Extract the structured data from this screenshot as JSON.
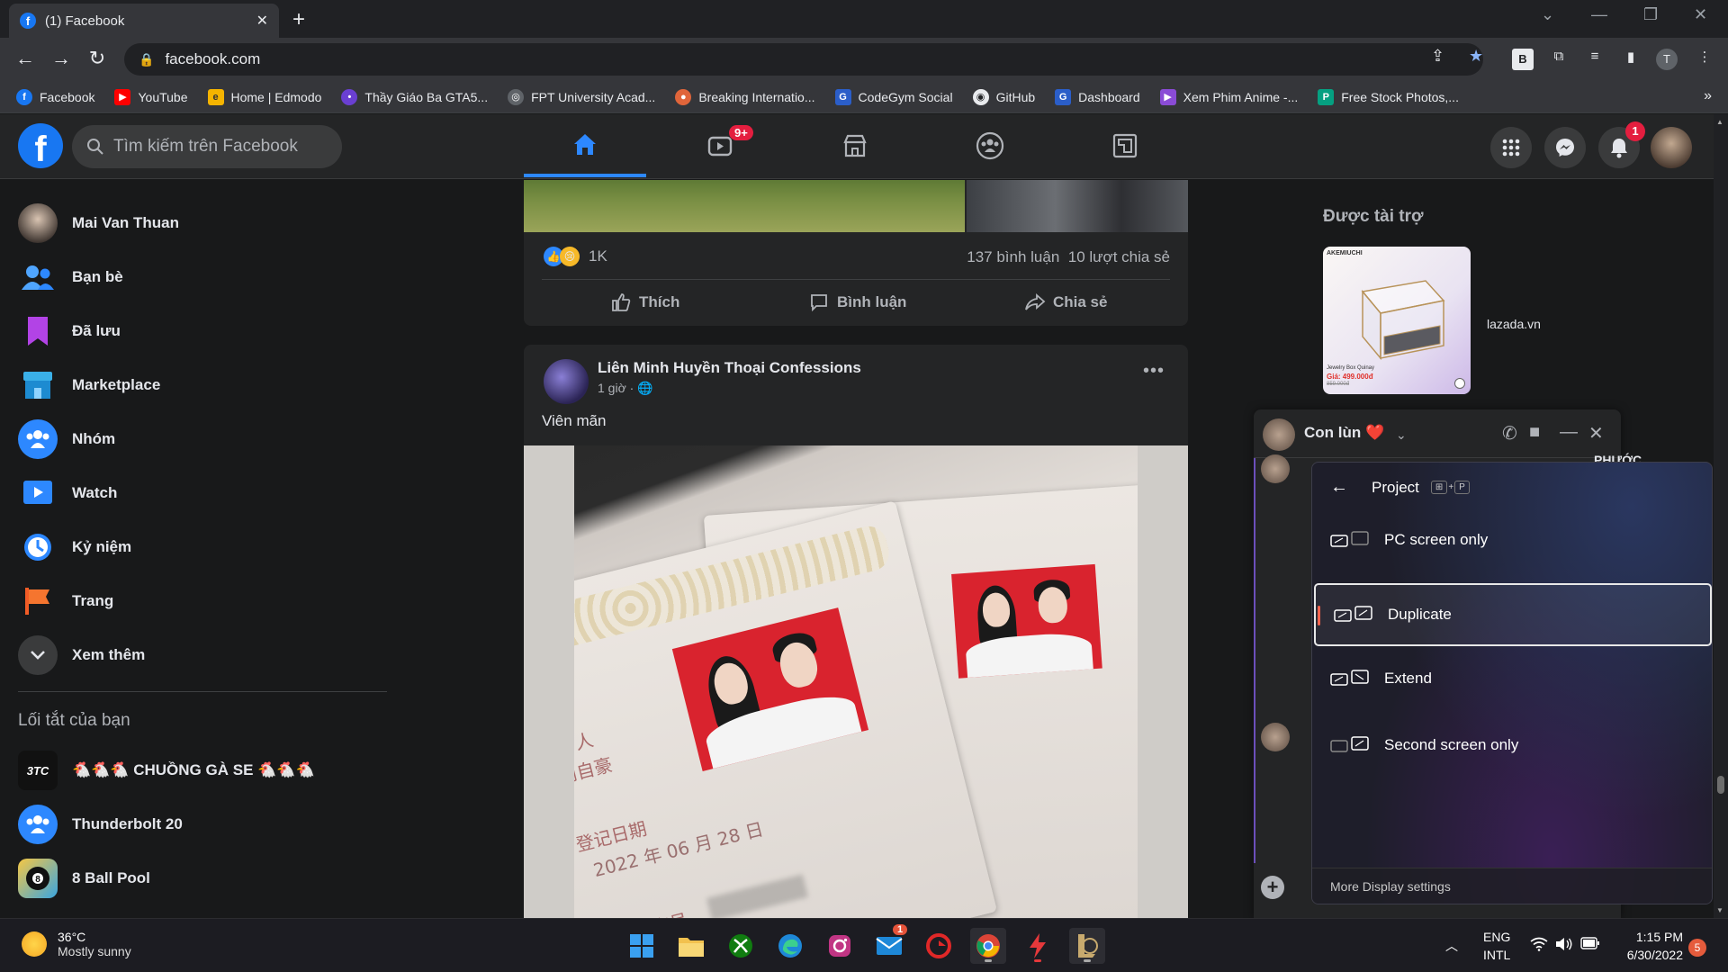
{
  "browser": {
    "tab_title": "(1) Facebook",
    "url": "facebook.com",
    "bookmarks": [
      {
        "label": "Facebook",
        "color": "#1877f2",
        "glyph": "f"
      },
      {
        "label": "YouTube",
        "color": "#ff0000",
        "glyph": "▶"
      },
      {
        "label": "Home | Edmodo",
        "color": "#f5b400",
        "glyph": "e"
      },
      {
        "label": "Thầy Giáo Ba GTA5...",
        "color": "#6a3fd1",
        "glyph": "•"
      },
      {
        "label": "FPT University Acad...",
        "color": "#5f6368",
        "glyph": "◎"
      },
      {
        "label": "Breaking Internatio...",
        "color": "#e0653a",
        "glyph": "●"
      },
      {
        "label": "CodeGym Social",
        "color": "#2b5ec9",
        "glyph": "G"
      },
      {
        "label": "GitHub",
        "color": "#24292e",
        "glyph": "◉"
      },
      {
        "label": "Dashboard",
        "color": "#2b5ec9",
        "glyph": "G"
      },
      {
        "label": "Xem Phim Anime -...",
        "color": "#8a4bd6",
        "glyph": "▶"
      },
      {
        "label": "Free Stock Photos,...",
        "color": "#05a081",
        "glyph": "P"
      }
    ],
    "profile_initial": "T"
  },
  "fb": {
    "search_placeholder": "Tìm kiếm trên Facebook",
    "watch_badge": "9+",
    "notif_badge": "1"
  },
  "sidebar": {
    "items": [
      {
        "label": "Mai Van Thuan"
      },
      {
        "label": "Bạn bè"
      },
      {
        "label": "Đã lưu"
      },
      {
        "label": "Marketplace"
      },
      {
        "label": "Nhóm"
      },
      {
        "label": "Watch"
      },
      {
        "label": "Kỷ niệm"
      },
      {
        "label": "Trang"
      },
      {
        "label": "Xem thêm"
      }
    ],
    "shortcuts_title": "Lối tắt của bạn",
    "shortcuts": [
      {
        "label": "🐔🐔🐔 CHUỒNG GÀ SE 🐔🐔🐔",
        "avatar_text": "3TC"
      },
      {
        "label": "Thunderbolt 20"
      },
      {
        "label": "8 Ball Pool"
      }
    ]
  },
  "post1": {
    "reaction_count": "1K",
    "comments": "137 bình luận",
    "shares": "10 lượt chia sẻ",
    "like": "Thích",
    "comment": "Bình luận",
    "share": "Chia sẻ"
  },
  "post2": {
    "author": "Liên Minh Huyền Thoại Confessions",
    "time": "1 giờ ·",
    "text": "Viên mãn",
    "photo_text": {
      "line1": "证 人",
      "line2": "简自豪",
      "line3": "登记日期",
      "line4": "2022 年 06 月 28 日",
      "line5": "结婚证字号"
    }
  },
  "right": {
    "sponsored": "Được tài trợ",
    "ad_site": "lazada.vn",
    "ad_brand": "AKEMIUCHI",
    "ad_product": "Jewelry Box Quinay",
    "ad_price": "Giá: 499.000đ",
    "ad_old_price": "859.000đ"
  },
  "chat": {
    "name": "Con lùn ❤️",
    "behind_text": "PHƯỚC"
  },
  "project": {
    "title": "Project",
    "shortcut_keys": [
      "⊞",
      "+",
      "P"
    ],
    "options": [
      {
        "label": "PC screen only"
      },
      {
        "label": "Duplicate"
      },
      {
        "label": "Extend"
      },
      {
        "label": "Second screen only"
      }
    ],
    "selected": "Duplicate",
    "footer": "More Display settings"
  },
  "taskbar": {
    "temp": "36°C",
    "weather": "Mostly sunny",
    "lang1": "ENG",
    "lang2": "INTL",
    "time": "1:15 PM",
    "date": "6/30/2022",
    "notif_count": "5",
    "mail_badge": "1"
  }
}
